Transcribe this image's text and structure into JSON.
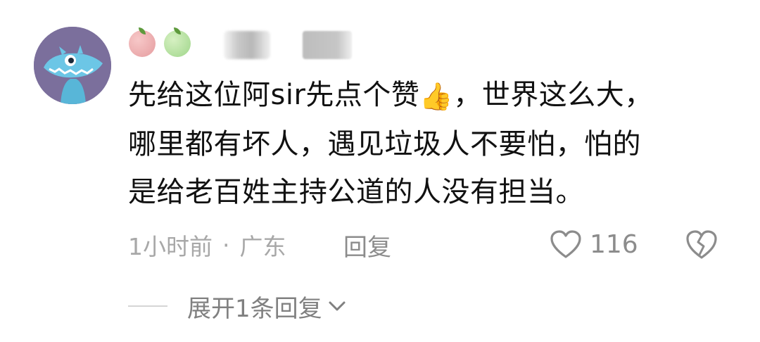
{
  "comment": {
    "username_blurred": true,
    "text_lines": [
      "先给这位阿sir先点个赞",
      "，世界这么大，",
      "哪里都有坏人，遇见垃圾人不要怕，怕的",
      "是给老百姓主持公道的人没有担当。"
    ],
    "thumb_emoji": "👍",
    "time": "1小时前",
    "separator": "·",
    "location": "广东",
    "reply_label": "回复",
    "like_count": "116",
    "expand_label": "展开1条回复"
  },
  "icons": {
    "avatar": "monster-avatar-icon",
    "badges": [
      "red-apple-icon",
      "green-apple-icon"
    ],
    "like": "heart-outline-icon",
    "dislike": "broken-heart-icon",
    "expand": "chevron-down-icon"
  },
  "colors": {
    "avatar_bg": "#7b6f9c",
    "text": "#111111",
    "meta_text": "#a8a8a8",
    "action_text": "#8c8c8c"
  }
}
